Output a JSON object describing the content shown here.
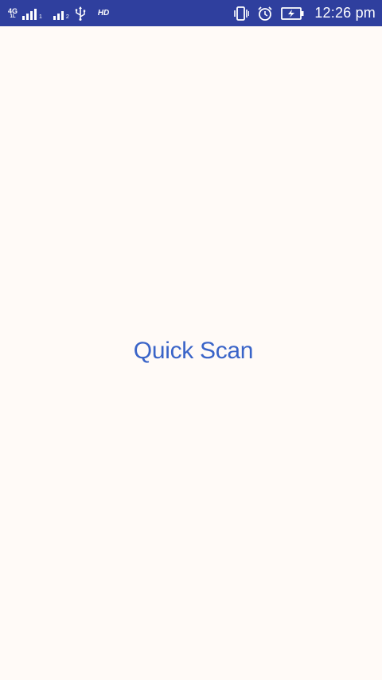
{
  "status_bar": {
    "network": {
      "type": "4G",
      "sub": "1L"
    },
    "sim1_number": "1",
    "sim2_number": "2",
    "hd_label": "HD",
    "time": "12:26 pm",
    "icons": [
      "signal-icon",
      "usb-icon",
      "vibrate-icon",
      "alarm-icon",
      "battery-charging-icon"
    ]
  },
  "main": {
    "action_label": "Quick Scan",
    "accent_color": "#3a64c8",
    "status_bar_color": "#2f3f9e",
    "background_color": "#fffaf7"
  }
}
